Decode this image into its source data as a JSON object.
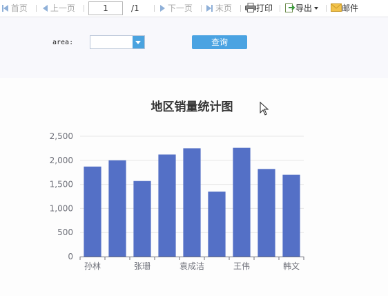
{
  "toolbar": {
    "first": "首页",
    "prev": "上一页",
    "page_value": "1",
    "page_total": "/1",
    "next": "下一页",
    "last": "末页",
    "print": "打印",
    "export": "导出",
    "mail": "邮件"
  },
  "filter": {
    "area_label": "area:",
    "area_value": "",
    "query_label": "查询"
  },
  "colors": {
    "bar": "#5470c6",
    "accent": "#4aa3df"
  },
  "chart_data": {
    "type": "bar",
    "title": "地区销量统计图",
    "categories": [
      "孙林",
      "",
      "张珊",
      "",
      "袁成洁",
      "",
      "王伟",
      "",
      "韩文"
    ],
    "values": [
      1870,
      2000,
      1570,
      2120,
      2250,
      1350,
      2260,
      1820,
      1700
    ],
    "ylim": [
      0,
      2500
    ],
    "yticks": [
      "0",
      "500",
      "1,000",
      "1,500",
      "2,000",
      "2,500"
    ],
    "xlabel": "",
    "ylabel": "",
    "grid": true,
    "legend": "none"
  }
}
